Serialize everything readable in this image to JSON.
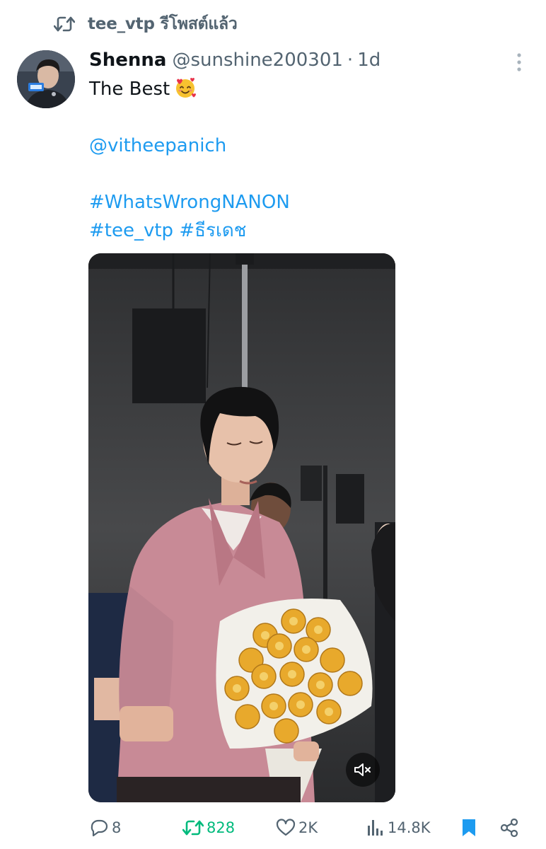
{
  "repost_banner": {
    "label": "tee_vtp รีโพสต์แล้ว",
    "icon": "repost-icon"
  },
  "tweet": {
    "author": {
      "display_name": "Shenna",
      "handle": "@sunshine200301",
      "separator": "·",
      "timestamp": "1d"
    },
    "text": {
      "line1": "The Best",
      "emoji": "smiling-face-with-hearts",
      "mention": "@vitheepanich",
      "hashtag1": "#WhatsWrongNANON",
      "hashtag2": "#tee_vtp #ธีรเดช"
    },
    "media": {
      "type": "video",
      "mute_icon": "speaker-muted-icon"
    }
  },
  "actions": {
    "reply": {
      "icon": "reply-icon",
      "count": "8"
    },
    "repost": {
      "icon": "repost-icon",
      "count": "828",
      "color": "#00ba7c"
    },
    "like": {
      "icon": "heart-icon",
      "count": "2K"
    },
    "views": {
      "icon": "views-icon",
      "count": "14.8K"
    },
    "bookmark": {
      "icon": "bookmark-icon",
      "color": "#1d9bf0"
    },
    "share": {
      "icon": "share-icon"
    }
  },
  "colors": {
    "link": "#1d9bf0",
    "muted_text": "#536471",
    "primary_text": "#0f1419"
  }
}
